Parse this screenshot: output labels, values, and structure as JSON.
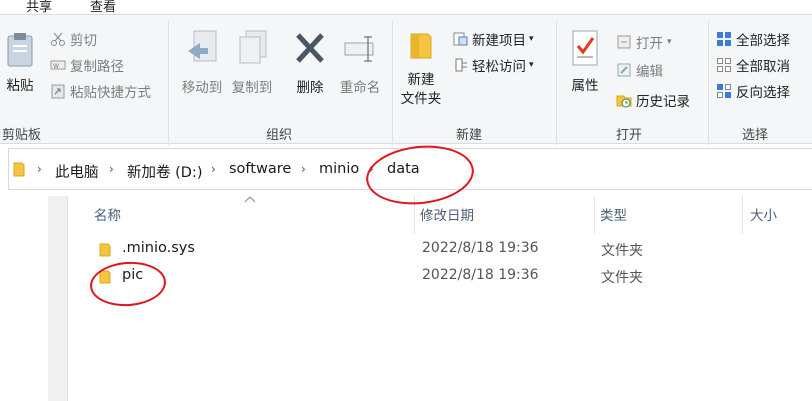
{
  "ribbon_tabs": [
    "共享",
    "查看"
  ],
  "clipboard": {
    "paste": "粘贴",
    "cut": "剪切",
    "copy_path": "复制路径",
    "paste_shortcut": "粘贴快捷方式",
    "label": "剪贴板"
  },
  "organize": {
    "move_to": "移动到",
    "copy_to": "复制到",
    "delete": "删除",
    "rename": "重命名",
    "label": "组织"
  },
  "new_group": {
    "new_item": "新建项目",
    "easy_access": "轻松访问",
    "new_folder_line1": "新建",
    "new_folder_line2": "文件夹",
    "label": "新建"
  },
  "open_group": {
    "properties": "属性",
    "open": "打开",
    "edit": "编辑",
    "history": "历史记录",
    "label": "打开"
  },
  "select_group": {
    "select_all": "全部选择",
    "select_none": "全部取消",
    "invert": "反向选择",
    "label": "选择"
  },
  "breadcrumbs": [
    "此电脑",
    "新加卷 (D:)",
    "software",
    "minio",
    "data"
  ],
  "columns": {
    "name": "名称",
    "modified": "修改日期",
    "type": "类型",
    "size": "大小"
  },
  "files": [
    {
      "name": ".minio.sys",
      "modified": "2022/8/18 19:36",
      "type": "文件夹"
    },
    {
      "name": "pic",
      "modified": "2022/8/18 19:36",
      "type": "文件夹"
    }
  ],
  "colors": {
    "annotation": "#e0141b",
    "folder": "#f5c542",
    "accent": "#1f6fd1"
  }
}
